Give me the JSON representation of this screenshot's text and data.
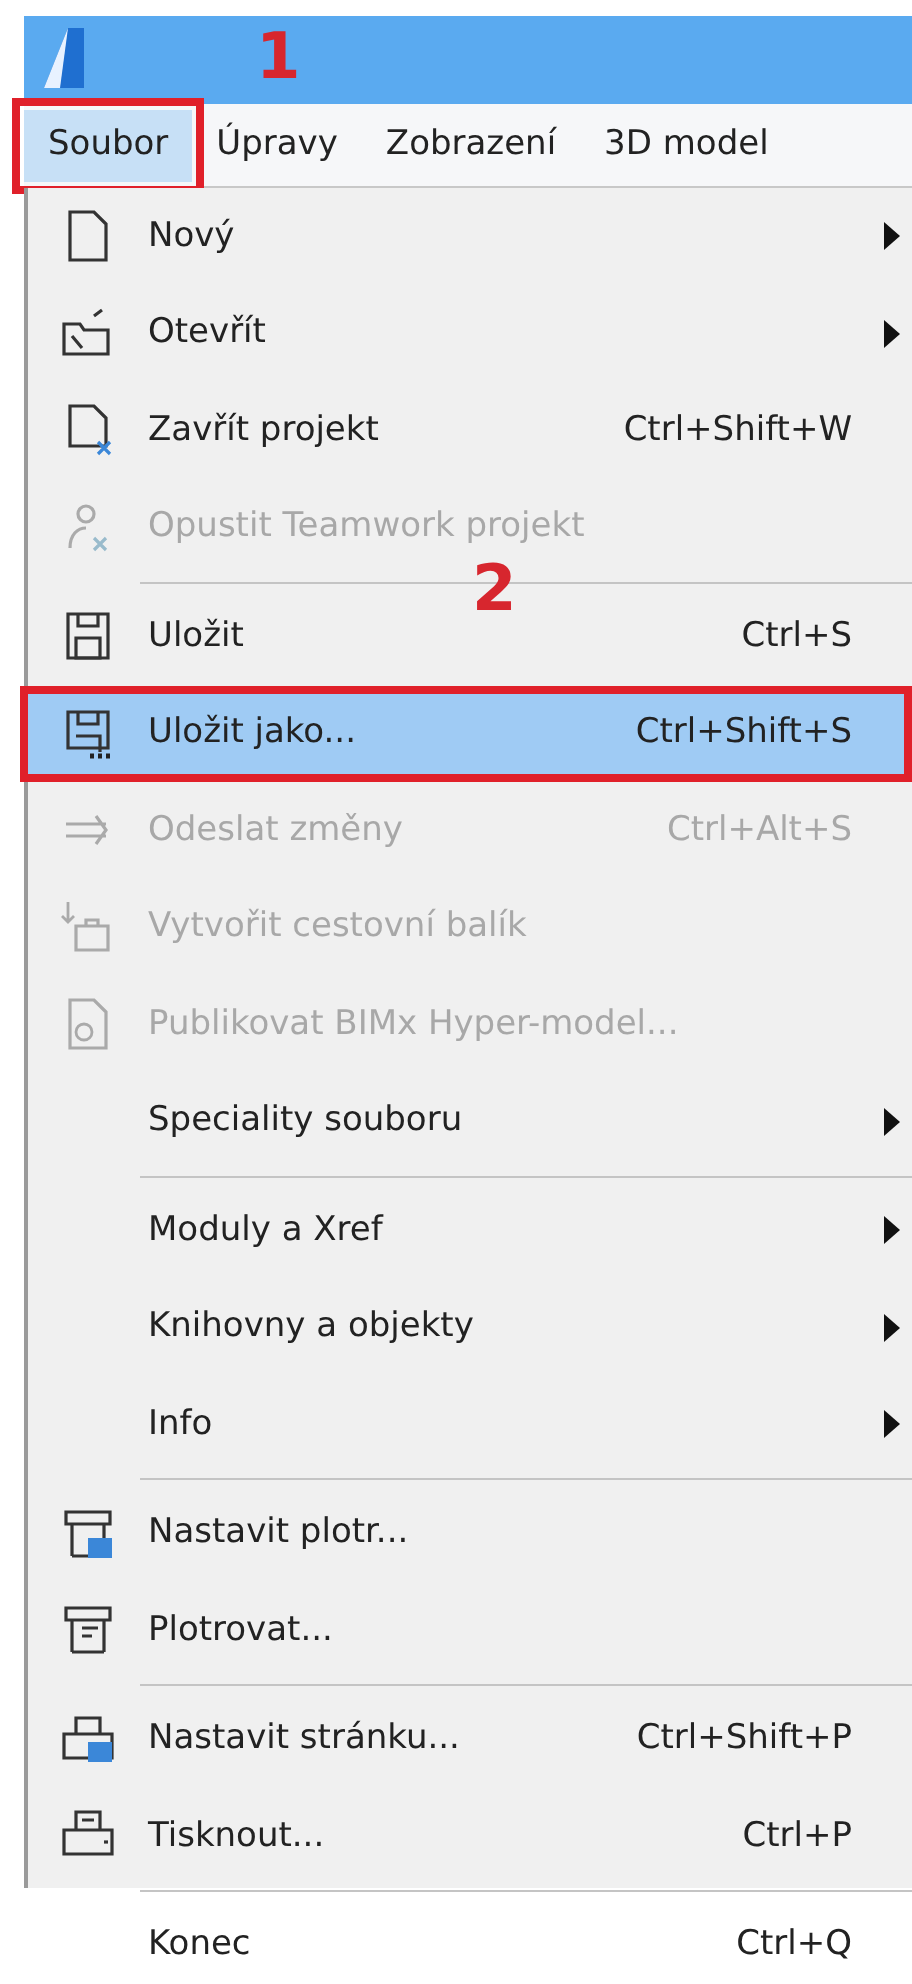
{
  "menubar": [
    {
      "label": "Soubor",
      "selected": true,
      "marked": true,
      "callout": "1"
    },
    {
      "label": "Úpravy",
      "selected": false,
      "marked": false
    },
    {
      "label": "Zobrazení",
      "selected": false,
      "marked": false
    },
    {
      "label": "3D model",
      "selected": false,
      "marked": false
    }
  ],
  "menu": [
    {
      "kind": "item",
      "label": "Nový",
      "submenu": true,
      "disabled": false,
      "selected": false
    },
    {
      "kind": "item",
      "label": "Otevřít",
      "submenu": true,
      "disabled": false,
      "selected": false
    },
    {
      "kind": "item",
      "label": "Zavřít projekt",
      "shortcut": "Ctrl+Shift+W",
      "submenu": false,
      "disabled": false,
      "selected": false
    },
    {
      "kind": "item",
      "label": "Opustit Teamwork projekt",
      "submenu": false,
      "disabled": true,
      "selected": false
    },
    {
      "kind": "separator"
    },
    {
      "kind": "item",
      "label": "Uložit",
      "shortcut": "Ctrl+S",
      "submenu": false,
      "disabled": false,
      "selected": false,
      "callout": "2"
    },
    {
      "kind": "item",
      "label": "Uložit jako...",
      "shortcut": "Ctrl+Shift+S",
      "submenu": false,
      "disabled": false,
      "selected": true,
      "marked": true
    },
    {
      "kind": "item",
      "label": "Odeslat změny",
      "shortcut": "Ctrl+Alt+S",
      "submenu": false,
      "disabled": true,
      "selected": false
    },
    {
      "kind": "item",
      "label": "Vytvořit cestovní balík",
      "submenu": false,
      "disabled": true,
      "selected": false
    },
    {
      "kind": "item",
      "label": "Publikovat BIMx Hyper-model...",
      "submenu": false,
      "disabled": true,
      "selected": false
    },
    {
      "kind": "item",
      "label": "Speciality souboru",
      "submenu": true,
      "disabled": false,
      "selected": false
    },
    {
      "kind": "separator"
    },
    {
      "kind": "item",
      "label": "Moduly a Xref",
      "submenu": true,
      "disabled": false,
      "selected": false
    },
    {
      "kind": "item",
      "label": "Knihovny a objekty",
      "submenu": true,
      "disabled": false,
      "selected": false
    },
    {
      "kind": "item",
      "label": "Info",
      "submenu": true,
      "disabled": false,
      "selected": false
    },
    {
      "kind": "separator"
    },
    {
      "kind": "item",
      "label": "Nastavit plotr...",
      "submenu": false,
      "disabled": false,
      "selected": false
    },
    {
      "kind": "item",
      "label": "Plotrovat...",
      "submenu": false,
      "disabled": false,
      "selected": false
    },
    {
      "kind": "separator"
    },
    {
      "kind": "item",
      "label": "Nastavit stránku...",
      "shortcut": "Ctrl+Shift+P",
      "submenu": false,
      "disabled": false,
      "selected": false
    },
    {
      "kind": "item",
      "label": "Tisknout...",
      "shortcut": "Ctrl+P",
      "submenu": false,
      "disabled": false,
      "selected": false
    },
    {
      "kind": "separator"
    },
    {
      "kind": "item",
      "label": "Konec",
      "shortcut": "Ctrl+Q",
      "submenu": false,
      "disabled": false,
      "selected": false
    }
  ]
}
